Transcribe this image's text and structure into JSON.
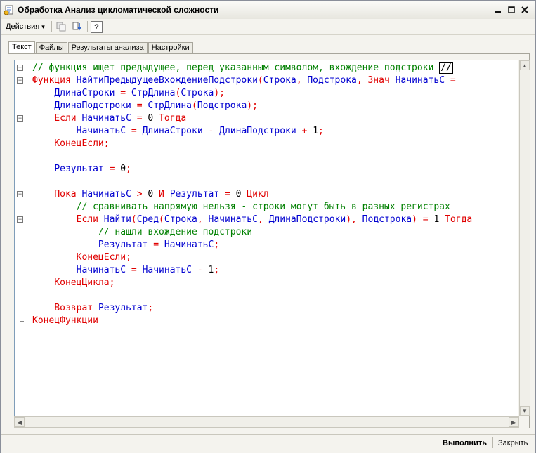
{
  "window": {
    "title": "Обработка  Анализ цикломатической сложности",
    "minimize_label": "_",
    "maximize_label": "□",
    "close_label": "X"
  },
  "toolbar": {
    "actions_label": "Действия",
    "actions_arrow": "▾",
    "help_label": "?"
  },
  "tabs": [
    {
      "label": "Текст",
      "active": true
    },
    {
      "label": "Файлы",
      "active": false
    },
    {
      "label": "Результаты анализа",
      "active": false
    },
    {
      "label": "Настройки",
      "active": false
    }
  ],
  "code_lines": [
    {
      "parts": [
        {
          "t": "// функция ищет предыдущее, перед указанным символом, вхождение подстроки ",
          "c": "cm"
        },
        {
          "t": "//",
          "c": "cursor"
        }
      ]
    },
    {
      "parts": [
        {
          "t": "Функция ",
          "c": "kw"
        },
        {
          "t": "НайтиПредыдущееВхождениеПодстроки",
          "c": "id"
        },
        {
          "t": "(",
          "c": "op"
        },
        {
          "t": "Строка",
          "c": "id"
        },
        {
          "t": ", ",
          "c": "op"
        },
        {
          "t": "Подстрока",
          "c": "id"
        },
        {
          "t": ", ",
          "c": "op"
        },
        {
          "t": "Знач ",
          "c": "kw"
        },
        {
          "t": "НачинатьС ",
          "c": "id"
        },
        {
          "t": "=",
          "c": "op"
        }
      ]
    },
    {
      "parts": [
        {
          "t": "    "
        },
        {
          "t": "ДлинаСтроки ",
          "c": "id"
        },
        {
          "t": "= ",
          "c": "op"
        },
        {
          "t": "СтрДлина",
          "c": "id"
        },
        {
          "t": "(",
          "c": "op"
        },
        {
          "t": "Строка",
          "c": "id"
        },
        {
          "t": ");",
          "c": "op"
        }
      ]
    },
    {
      "parts": [
        {
          "t": "    "
        },
        {
          "t": "ДлинаПодстроки ",
          "c": "id"
        },
        {
          "t": "= ",
          "c": "op"
        },
        {
          "t": "СтрДлина",
          "c": "id"
        },
        {
          "t": "(",
          "c": "op"
        },
        {
          "t": "Подстрока",
          "c": "id"
        },
        {
          "t": ");",
          "c": "op"
        }
      ]
    },
    {
      "parts": [
        {
          "t": "    "
        },
        {
          "t": "Если ",
          "c": "kw"
        },
        {
          "t": "НачинатьС ",
          "c": "id"
        },
        {
          "t": "= ",
          "c": "op"
        },
        {
          "t": "0 ",
          "c": "num"
        },
        {
          "t": "Тогда",
          "c": "kw"
        }
      ]
    },
    {
      "parts": [
        {
          "t": "        "
        },
        {
          "t": "НачинатьС ",
          "c": "id"
        },
        {
          "t": "= ",
          "c": "op"
        },
        {
          "t": "ДлинаСтроки ",
          "c": "id"
        },
        {
          "t": "- ",
          "c": "op"
        },
        {
          "t": "ДлинаПодстроки ",
          "c": "id"
        },
        {
          "t": "+ ",
          "c": "op"
        },
        {
          "t": "1",
          "c": "num"
        },
        {
          "t": ";",
          "c": "op"
        }
      ]
    },
    {
      "parts": [
        {
          "t": "    "
        },
        {
          "t": "КонецЕсли",
          "c": "kw"
        },
        {
          "t": ";",
          "c": "op"
        }
      ]
    },
    {
      "parts": []
    },
    {
      "parts": [
        {
          "t": "    "
        },
        {
          "t": "Результат ",
          "c": "id"
        },
        {
          "t": "= ",
          "c": "op"
        },
        {
          "t": "0",
          "c": "num"
        },
        {
          "t": ";",
          "c": "op"
        }
      ]
    },
    {
      "parts": []
    },
    {
      "parts": [
        {
          "t": "    "
        },
        {
          "t": "Пока ",
          "c": "kw"
        },
        {
          "t": "НачинатьС ",
          "c": "id"
        },
        {
          "t": "> ",
          "c": "op"
        },
        {
          "t": "0 ",
          "c": "num"
        },
        {
          "t": "И ",
          "c": "kw"
        },
        {
          "t": "Результат ",
          "c": "id"
        },
        {
          "t": "= ",
          "c": "op"
        },
        {
          "t": "0 ",
          "c": "num"
        },
        {
          "t": "Цикл",
          "c": "kw"
        }
      ]
    },
    {
      "parts": [
        {
          "t": "        "
        },
        {
          "t": "// сравнивать напрямую нельзя - строки могут быть в разных регистрах",
          "c": "cm"
        }
      ]
    },
    {
      "parts": [
        {
          "t": "        "
        },
        {
          "t": "Если ",
          "c": "kw"
        },
        {
          "t": "Найти",
          "c": "id"
        },
        {
          "t": "(",
          "c": "op"
        },
        {
          "t": "Сред",
          "c": "id"
        },
        {
          "t": "(",
          "c": "op"
        },
        {
          "t": "Строка",
          "c": "id"
        },
        {
          "t": ", ",
          "c": "op"
        },
        {
          "t": "НачинатьС",
          "c": "id"
        },
        {
          "t": ", ",
          "c": "op"
        },
        {
          "t": "ДлинаПодстроки",
          "c": "id"
        },
        {
          "t": "), ",
          "c": "op"
        },
        {
          "t": "Подстрока",
          "c": "id"
        },
        {
          "t": ") = ",
          "c": "op"
        },
        {
          "t": "1 ",
          "c": "num"
        },
        {
          "t": "Тогда",
          "c": "kw"
        }
      ]
    },
    {
      "parts": [
        {
          "t": "            "
        },
        {
          "t": "// нашли вхождение подстроки",
          "c": "cm"
        }
      ]
    },
    {
      "parts": [
        {
          "t": "            "
        },
        {
          "t": "Результат ",
          "c": "id"
        },
        {
          "t": "= ",
          "c": "op"
        },
        {
          "t": "НачинатьС",
          "c": "id"
        },
        {
          "t": ";",
          "c": "op"
        }
      ]
    },
    {
      "parts": [
        {
          "t": "        "
        },
        {
          "t": "КонецЕсли",
          "c": "kw"
        },
        {
          "t": ";",
          "c": "op"
        }
      ]
    },
    {
      "parts": [
        {
          "t": "        "
        },
        {
          "t": "НачинатьС ",
          "c": "id"
        },
        {
          "t": "= ",
          "c": "op"
        },
        {
          "t": "НачинатьС ",
          "c": "id"
        },
        {
          "t": "- ",
          "c": "op"
        },
        {
          "t": "1",
          "c": "num"
        },
        {
          "t": ";",
          "c": "op"
        }
      ]
    },
    {
      "parts": [
        {
          "t": "    "
        },
        {
          "t": "КонецЦикла",
          "c": "kw"
        },
        {
          "t": ";",
          "c": "op"
        }
      ]
    },
    {
      "parts": []
    },
    {
      "parts": [
        {
          "t": "    "
        },
        {
          "t": "Возврат ",
          "c": "kw"
        },
        {
          "t": "Результат",
          "c": "id"
        },
        {
          "t": ";",
          "c": "op"
        }
      ]
    },
    {
      "parts": [
        {
          "t": "КонецФункции",
          "c": "kw"
        }
      ]
    }
  ],
  "gutter_marks": [
    {
      "line": 0,
      "type": "expand"
    },
    {
      "line": 1,
      "type": "collapse"
    },
    {
      "line": 4,
      "type": "collapse"
    },
    {
      "line": 6,
      "type": "tick"
    },
    {
      "line": 10,
      "type": "collapse"
    },
    {
      "line": 12,
      "type": "collapse"
    },
    {
      "line": 15,
      "type": "tick"
    },
    {
      "line": 17,
      "type": "tick"
    },
    {
      "line": 20,
      "type": "end"
    }
  ],
  "buttons": {
    "run_label": "Выполнить",
    "close_label": "Закрыть"
  },
  "colors": {
    "comment": "#008000",
    "keyword": "#e00000",
    "identifier": "#0000d0"
  }
}
